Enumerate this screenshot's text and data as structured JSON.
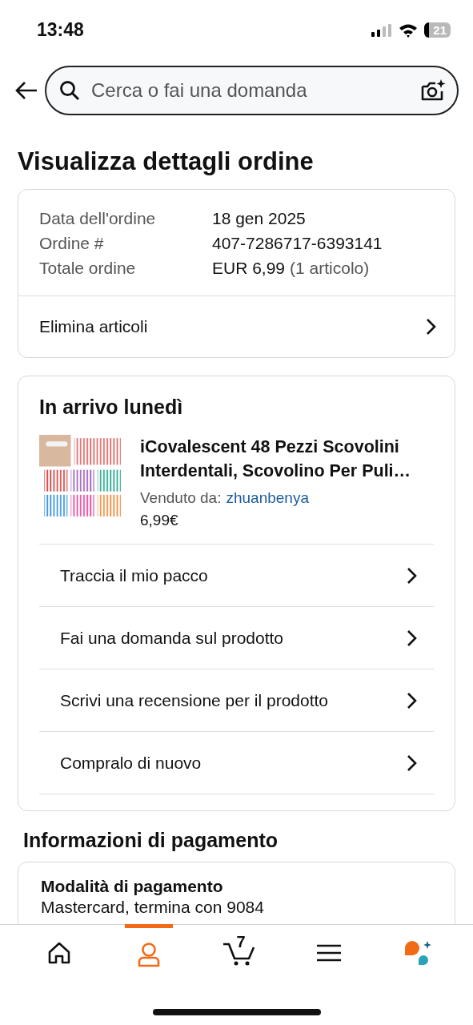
{
  "status_bar": {
    "time": "13:48",
    "battery": "21"
  },
  "search": {
    "placeholder": "Cerca o fai una domanda"
  },
  "title": "Visualizza dettagli ordine",
  "summary": {
    "rows": [
      {
        "label": "Data dell'ordine",
        "value": "18 gen 2025"
      },
      {
        "label": "Ordine #",
        "value": "407-7286717-6393141"
      },
      {
        "label": "Totale ordine",
        "value": "EUR 6,99",
        "note": "(1 articolo)"
      }
    ],
    "action": "Elimina articoli"
  },
  "shipment": {
    "heading": "In arrivo lunedì",
    "product": {
      "kind": "picture",
      "title": "iCovalescent 48 Pezzi Scovolini\nInterdentali, Scovolino Per Puli…",
      "seller_label": "Venduto da:",
      "seller": "zhuanbenya",
      "price": "6,99€"
    },
    "actions": [
      "Traccia il mio pacco",
      "Fai una domanda sul prodotto",
      "Scrivi una recensione per il prodotto",
      "Compralo di nuovo"
    ]
  },
  "payment": {
    "heading": "Informazioni di pagamento",
    "method_title": "Modalità di pagamento",
    "method": "Mastercard, termina con 9084"
  },
  "nav": [
    {
      "kind": "home",
      "selected": false
    },
    {
      "kind": "account",
      "selected": true
    },
    {
      "kind": "cart",
      "selected": false,
      "count": "7"
    },
    {
      "kind": "menu",
      "selected": false
    },
    {
      "kind": "assistant",
      "selected": false
    }
  ]
}
